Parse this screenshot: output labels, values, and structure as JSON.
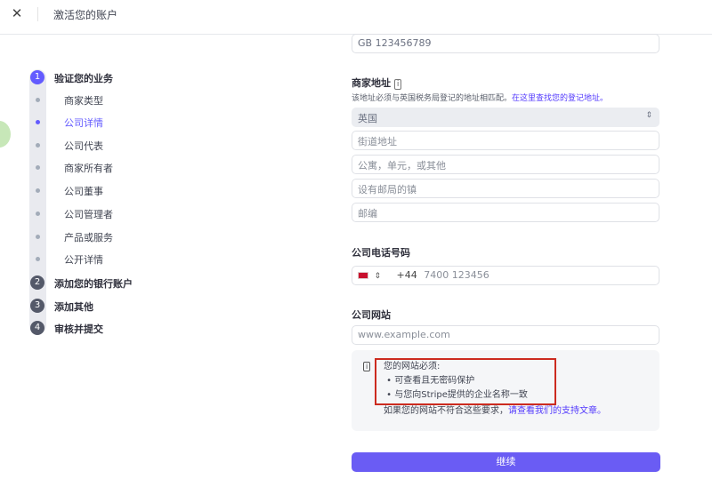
{
  "header": {
    "title": "激活您的账户",
    "close_icon": "close-icon"
  },
  "stepper": {
    "steps": [
      {
        "num": "1",
        "label": "验证您的业务",
        "color": "#635bff"
      },
      {
        "num": "2",
        "label": "添加您的银行账户",
        "color": "#545969"
      },
      {
        "num": "3",
        "label": "添加其他",
        "color": "#545969"
      },
      {
        "num": "4",
        "label": "审核并提交",
        "color": "#545969"
      }
    ],
    "substeps": [
      "商家类型",
      "公司详情",
      "公司代表",
      "商家所有者",
      "公司董事",
      "公司管理者",
      "产品或服务",
      "公开详情"
    ],
    "active_substep": "公司详情"
  },
  "form": {
    "vat_value": "GB 123456789",
    "address": {
      "label": "商家地址",
      "help": "该地址必须与英国税务局登记的地址相匹配。",
      "help_link": "在这里查找您的登记地址。",
      "country": "英国",
      "street_ph": "街道地址",
      "apt_ph": "公寓，单元，或其他",
      "town_ph": "设有邮局的镇",
      "postcode_ph": "邮编"
    },
    "phone": {
      "label": "公司电话号码",
      "code": "+44",
      "placeholder": "7400 123456",
      "flag": "uk-flag-icon"
    },
    "website": {
      "label": "公司网站",
      "placeholder": "www.example.com",
      "info_title": "您的网站必须:",
      "rules": [
        "可查看且无密码保护",
        "与您向Stripe提供的企业名称一致"
      ],
      "footer": "如果您的网站不符合这些要求，",
      "footer_link": "请查看我们的支持文章。"
    },
    "continue": "继续"
  },
  "colors": {
    "accent": "#635bff",
    "highlight": "#cc2b1f"
  }
}
